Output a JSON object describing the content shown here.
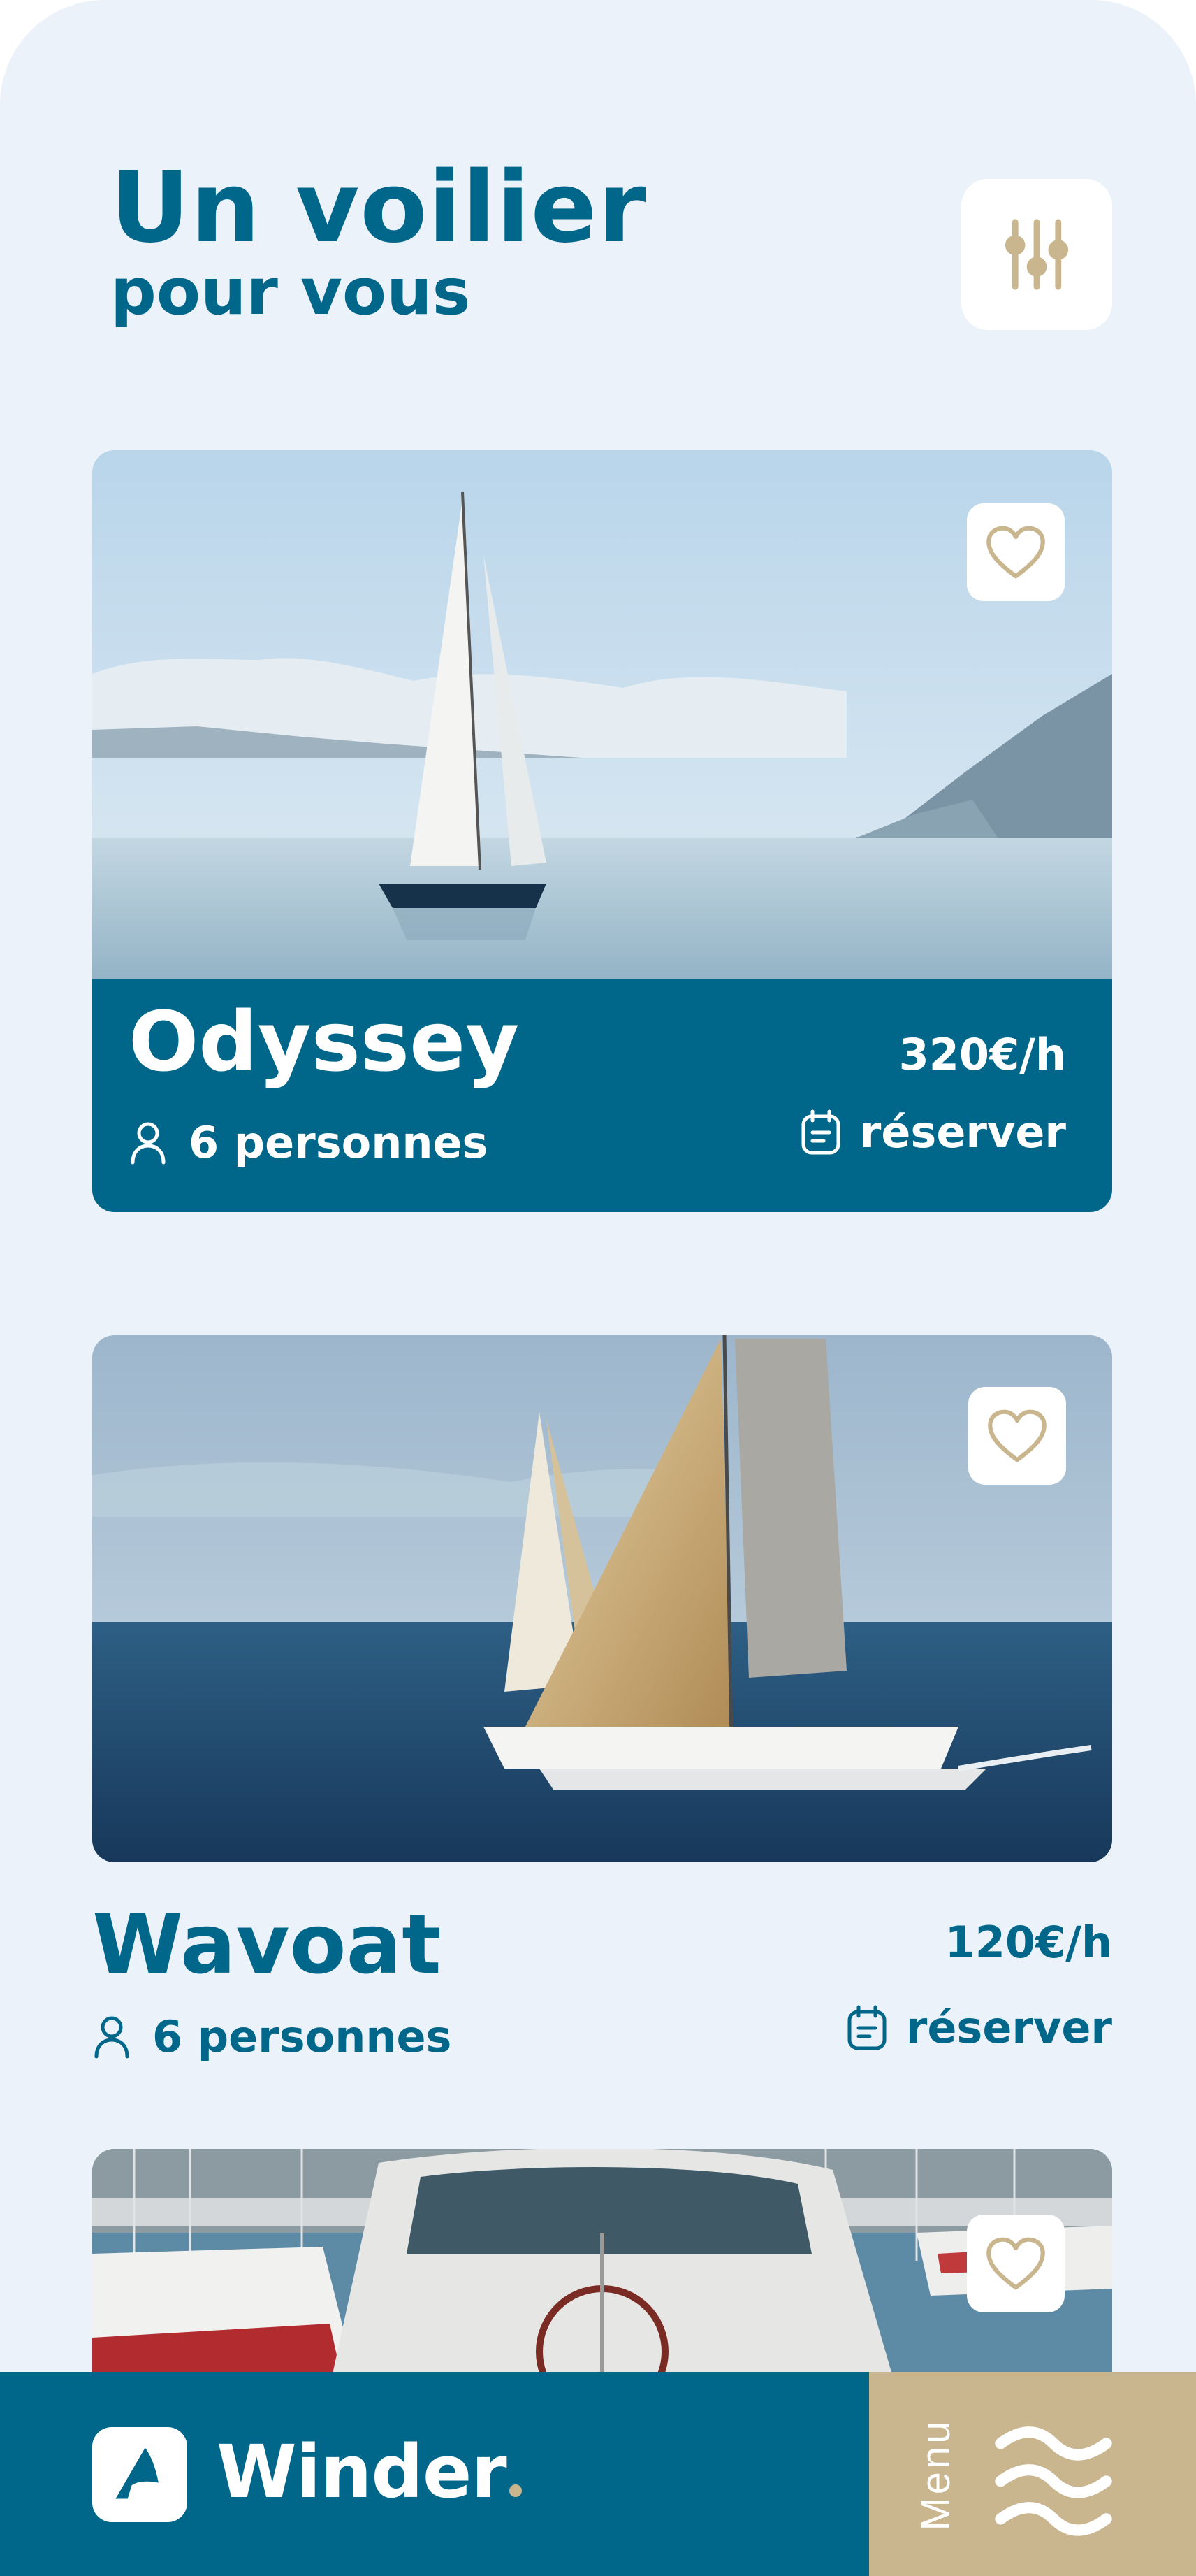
{
  "header": {
    "title": "Un voilier",
    "subtitle": "pour vous",
    "filter_icon": "sliders-icon"
  },
  "boats": [
    {
      "name": "Odyssey",
      "capacity": "6 personnes",
      "price": "320€/h",
      "reserve_label": "réserver",
      "favorite_icon": "heart-icon"
    },
    {
      "name": "Wavoat",
      "capacity": "6 personnes",
      "price": "120€/h",
      "reserve_label": "réserver",
      "favorite_icon": "heart-icon"
    },
    {
      "favorite_icon": "heart-icon"
    }
  ],
  "bottom_nav": {
    "brand": "Winder",
    "menu_label": "Menu",
    "menu_icon": "waves-menu-icon"
  },
  "colors": {
    "primary": "#00678b",
    "accent": "#c9b58e",
    "background": "#ebf2fa"
  }
}
